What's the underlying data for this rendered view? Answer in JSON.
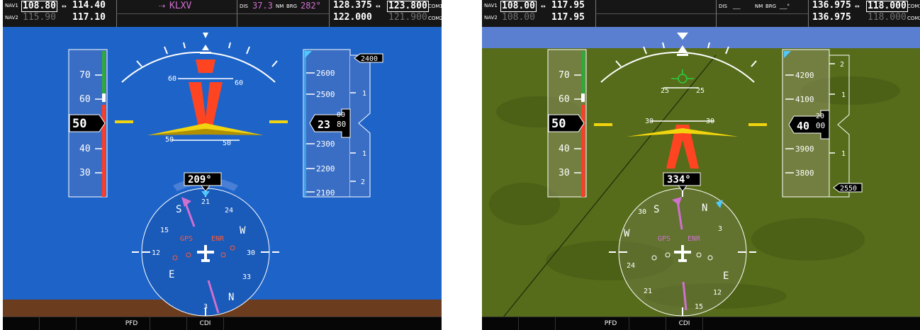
{
  "pfds": [
    {
      "nav1_label": "NAV1",
      "nav1_active": "108.80",
      "nav1_standby": "114.40",
      "nav2_label": "NAV2",
      "nav2_active": "115.90",
      "nav2_standby": "117.10",
      "swap_arrow": "↔",
      "waypoint": "KLXV",
      "waypoint_icon": "dtk-arrow-icon",
      "dis_label": "DIS",
      "dis_value": "37.3",
      "dis_unit": "NM",
      "brg_label": "BRG",
      "brg_value": "282°",
      "com1_active": "128.375",
      "com1_standby": "123.800",
      "com1_label": "COM1",
      "com2_active": "122.000",
      "com2_standby": "121.900",
      "com2_label": "COM2",
      "airspeed": "50",
      "airspeed_ticks": [
        "70",
        "60",
        "40",
        "30"
      ],
      "altitude": "2380",
      "altitude_main": "23",
      "altitude_roll": "80",
      "altitude_roll_above": "00",
      "altitude_ticks": [
        "2600",
        "2500",
        "2300",
        "2200",
        "2100"
      ],
      "selected_altitude": "2400",
      "vsi_ticks": [
        "1",
        "1",
        "2"
      ],
      "heading": "209°",
      "pitch_marks": [
        "60",
        "60",
        "50",
        "50"
      ],
      "hsi_labels": [
        "S",
        "21",
        "24",
        "W",
        "30",
        "33",
        "N",
        "3",
        "E",
        "12",
        "15"
      ],
      "hsi_gps": "GPS",
      "hsi_enr": "ENR",
      "colors": {
        "sky": "#1e64c8",
        "ground": "#6b3c1e",
        "chevron": "#ff4422",
        "cdi": "#d070d0"
      },
      "softkeys": [
        "",
        "",
        "PFD",
        "",
        "CDI",
        "",
        "",
        "",
        "",
        "",
        "",
        ""
      ]
    },
    {
      "nav1_label": "NAV1",
      "nav1_active": "108.00",
      "nav1_standby": "117.95",
      "nav2_label": "NAV2",
      "nav2_active": "108.00",
      "nav2_standby": "117.95",
      "swap_arrow": "↔",
      "dis_label": "DIS",
      "dis_value": "___",
      "dis_unit": "NM",
      "brg_label": "BRG",
      "brg_value": "___°",
      "com1_active": "136.975",
      "com1_standby": "118.000",
      "com1_label": "COM1",
      "com2_active": "136.975",
      "com2_standby": "118.000",
      "com2_label": "COM2",
      "airspeed": "50",
      "airspeed_ticks": [
        "70",
        "60",
        "40",
        "30"
      ],
      "altitude": "4000",
      "altitude_main": "40",
      "altitude_roll": "00",
      "altitude_roll_above": "20",
      "altitude_ticks": [
        "4200",
        "4100",
        "3900",
        "3800"
      ],
      "selected_altitude": "2550",
      "vsi_ticks": [
        "2",
        "1",
        "1"
      ],
      "heading": "334°",
      "pitch_marks": [
        "25",
        "25",
        "30",
        "30"
      ],
      "hsi_labels": [
        "S",
        "N",
        "3",
        "E",
        "30",
        "W",
        "24",
        "21",
        "12",
        "15"
      ],
      "hsi_gps": "GPS",
      "hsi_enr": "ENR",
      "colors": {
        "sky": "#5a7fd0",
        "ground": "#566c1a",
        "chevron": "#ff4422",
        "cdi": "#d070d0"
      },
      "softkeys": [
        "",
        "",
        "PFD",
        "",
        "CDI",
        "",
        "",
        "",
        "",
        "",
        "",
        ""
      ]
    }
  ]
}
